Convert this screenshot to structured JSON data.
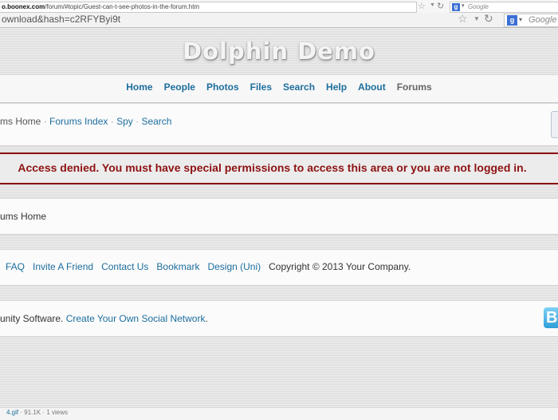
{
  "browser": {
    "url_domain": "o.boonex.com",
    "url_path": "/forum/#topic/Guest-can-t-see-photos-in-the-forum.htm",
    "search_placeholder_1": "Google",
    "url2": "ownload&hash=c2RFYByi9t",
    "search_placeholder_2": "Google"
  },
  "site": {
    "title": "Dolphin Demo"
  },
  "nav": {
    "items": [
      {
        "label": "Home"
      },
      {
        "label": "People"
      },
      {
        "label": "Photos"
      },
      {
        "label": "Files"
      },
      {
        "label": "Search"
      },
      {
        "label": "Help"
      },
      {
        "label": "About"
      },
      {
        "label": "Forums"
      }
    ]
  },
  "breadcrumb": {
    "home": "ms Home",
    "sep": "·",
    "links": [
      "Forums Index",
      "Spy",
      "Search"
    ]
  },
  "alert": {
    "message": "Access denied. You must have special permissions to access this area or you are not logged in."
  },
  "content": {
    "crumb_text": "ums Home"
  },
  "footer": {
    "links": [
      "FAQ",
      "Invite A Friend",
      "Contact Us",
      "Bookmark",
      "Design (Uni)"
    ],
    "copyright": "Copyright © 2013 Your Company.",
    "powered_prefix": "unity Software.",
    "powered_link": "Create Your Own Social Network",
    "powered_suffix": ".",
    "logo_letter": "B"
  },
  "status": {
    "file": "4.gif",
    "sep": "·",
    "size": "91.1K",
    "views": "1 views"
  }
}
